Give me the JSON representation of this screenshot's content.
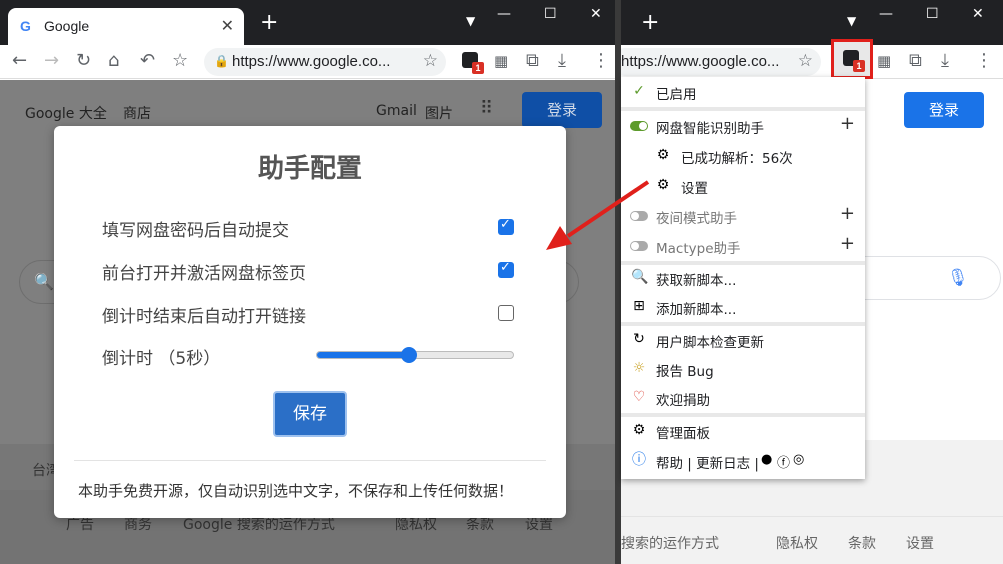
{
  "left_window": {
    "tab_title": "Google",
    "tab_icon": "google-g-icon",
    "url": "https://www.google.co...",
    "page": {
      "top_links": [
        "Google 大全",
        "商店"
      ],
      "right_links": [
        "Gmail",
        "图片"
      ],
      "login_label": "登录",
      "region_label": "台湾",
      "footer_links": [
        "广告",
        "商务",
        "Google 搜索的运作方式",
        "隐私权",
        "条款",
        "设置"
      ]
    }
  },
  "right_window": {
    "url": "https://www.google.co...",
    "login_label": "登录",
    "footer_links": [
      "搜索的运作方式",
      "隐私权",
      "条款",
      "设置"
    ]
  },
  "dialog": {
    "title": "助手配置",
    "options": [
      {
        "label": "填写网盘密码后自动提交",
        "checked": true
      },
      {
        "label": "前台打开并激活网盘标签页",
        "checked": true
      },
      {
        "label": "倒计时结束后自动打开链接",
        "checked": false
      }
    ],
    "countdown_label": "倒计时 （5秒）",
    "countdown_level": 0.47,
    "save_label": "保存",
    "note": "本助手免费开源，仅自动识别选中文字，不保存和上传任何数据！"
  },
  "menu": {
    "enabled_label": "已启用",
    "items": [
      {
        "label": "网盘智能识别助手",
        "toggle": "on",
        "plus": true
      },
      {
        "label": "已成功解析：56次",
        "icon": "gears-icon"
      },
      {
        "label": "设置",
        "icon": "gears-icon"
      },
      {
        "label": "夜间模式助手",
        "toggle": "off",
        "plus": true
      },
      {
        "label": "Mactype助手",
        "toggle": "off",
        "plus": true
      }
    ],
    "get_scripts": "获取新脚本...",
    "add_script": "添加新脚本...",
    "check_updates": "用户脚本检查更新",
    "report_bug": "报告 Bug",
    "donate": "欢迎捐助",
    "dashboard": "管理面板",
    "help": "帮助 | 更新日志 |"
  },
  "colors": {
    "accent": "#1a73e8",
    "highlight_box": "#e0201b",
    "arrow": "#e0201b",
    "toggle_on": "#5d9b2c"
  }
}
